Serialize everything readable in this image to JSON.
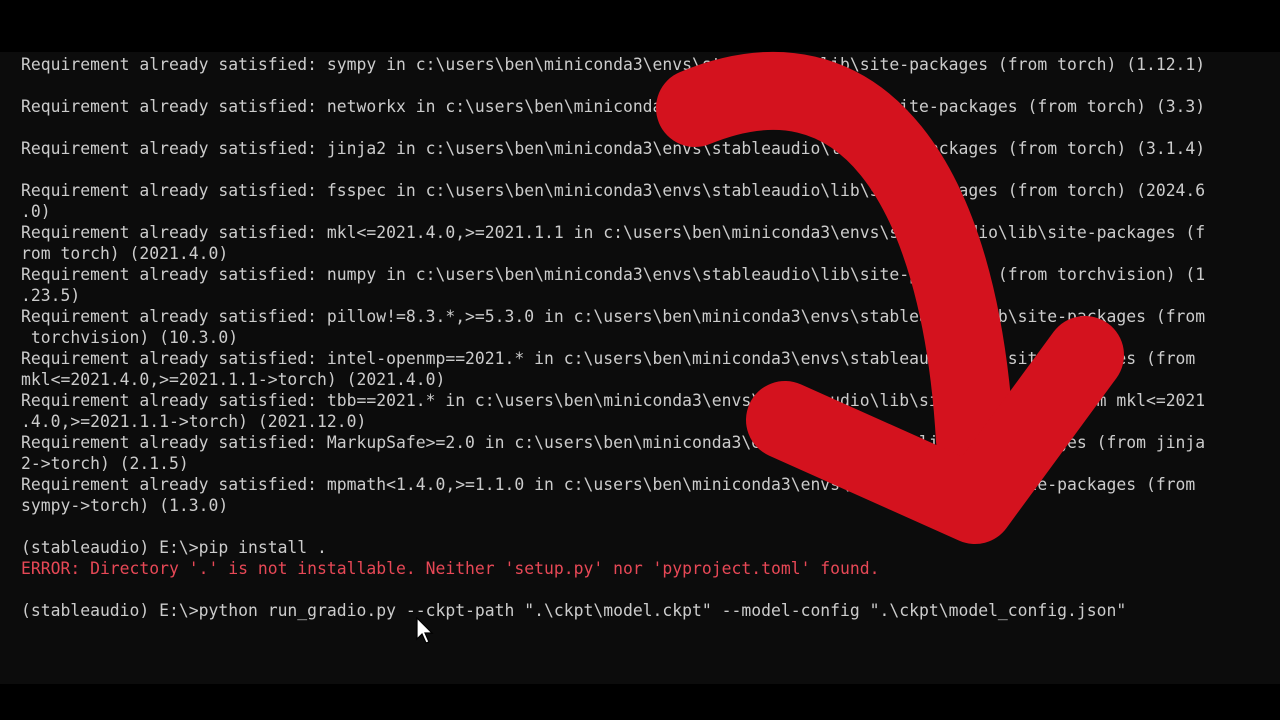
{
  "terminal": {
    "lines": [
      "Requirement already satisfied: sympy in c:\\users\\ben\\miniconda3\\envs\\stableaudio\\lib\\site-packages (from torch) (1.12.1)",
      "",
      "Requirement already satisfied: networkx in c:\\users\\ben\\miniconda3\\envs\\stableaudio\\lib\\site-packages (from torch) (3.3)",
      "",
      "Requirement already satisfied: jinja2 in c:\\users\\ben\\miniconda3\\envs\\stableaudio\\lib\\site-packages (from torch) (3.1.4)",
      "",
      "Requirement already satisfied: fsspec in c:\\users\\ben\\miniconda3\\envs\\stableaudio\\lib\\site-packages (from torch) (2024.6",
      ".0)",
      "Requirement already satisfied: mkl<=2021.4.0,>=2021.1.1 in c:\\users\\ben\\miniconda3\\envs\\stableaudio\\lib\\site-packages (f",
      "rom torch) (2021.4.0)",
      "Requirement already satisfied: numpy in c:\\users\\ben\\miniconda3\\envs\\stableaudio\\lib\\site-packages (from torchvision) (1",
      ".23.5)",
      "Requirement already satisfied: pillow!=8.3.*,>=5.3.0 in c:\\users\\ben\\miniconda3\\envs\\stableaudio\\lib\\site-packages (from",
      " torchvision) (10.3.0)",
      "Requirement already satisfied: intel-openmp==2021.* in c:\\users\\ben\\miniconda3\\envs\\stableaudio\\lib\\site-packages (from",
      "mkl<=2021.4.0,>=2021.1.1->torch) (2021.4.0)",
      "Requirement already satisfied: tbb==2021.* in c:\\users\\ben\\miniconda3\\envs\\stableaudio\\lib\\site-packages (from mkl<=2021",
      ".4.0,>=2021.1.1->torch) (2021.12.0)",
      "Requirement already satisfied: MarkupSafe>=2.0 in c:\\users\\ben\\miniconda3\\envs\\stableaudio\\lib\\site-packages (from jinja",
      "2->torch) (2.1.5)",
      "Requirement already satisfied: mpmath<1.4.0,>=1.1.0 in c:\\users\\ben\\miniconda3\\envs\\stableaudio\\lib\\site-packages (from",
      "sympy->torch) (1.3.0)",
      "",
      "(stableaudio) E:\\>pip install .",
      "ERROR: Directory '.' is not installable. Neither 'setup.py' nor 'pyproject.toml' found.",
      "",
      "(stableaudio) E:\\>python run_gradio.py --ckpt-path \".\\ckpt\\model.ckpt\" --model-config \".\\ckpt\\model_config.json\""
    ],
    "error_line_index": 24
  },
  "colors": {
    "terminal_bg": "#0c0c0c",
    "text": "#cccccc",
    "error": "#e74856",
    "arrow": "#d4121e"
  },
  "overlay": {
    "arrow_icon": "curved-arrow-icon",
    "cursor_icon": "mouse-pointer-icon"
  }
}
